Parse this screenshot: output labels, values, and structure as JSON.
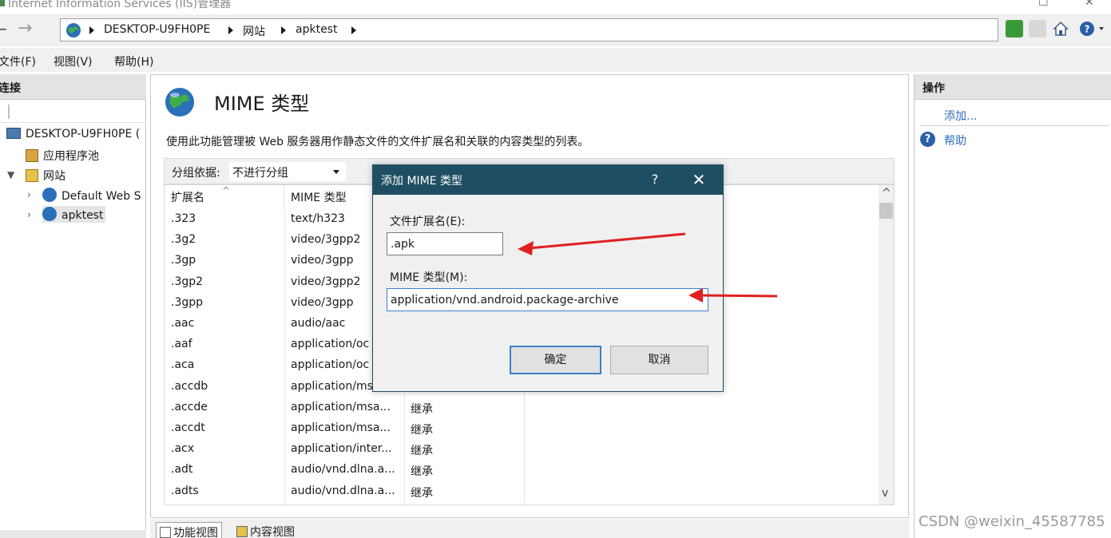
{
  "window": {
    "title": "Internet Information Services (IIS)管理器"
  },
  "address_bar": {
    "crumbs": [
      "DESKTOP-U9FH0PE",
      "网站",
      "apktest"
    ]
  },
  "menu": {
    "items": [
      "文件(F)",
      "视图(V)",
      "帮助(H)"
    ]
  },
  "connections": {
    "header": "连接",
    "tree": [
      {
        "label": "DESKTOP-U9FH0PE (",
        "level": 0
      },
      {
        "label": "应用程序池",
        "level": 1
      },
      {
        "label": "网站",
        "level": 1
      },
      {
        "label": "Default Web S",
        "level": 2
      },
      {
        "label": "apktest",
        "level": 2,
        "selected": true
      }
    ]
  },
  "main": {
    "title": "MIME 类型",
    "description": "使用此功能管理被 Web 服务器用作静态文件的文件扩展名和关联的内容类型的列表。",
    "group_by_label": "分组依据:",
    "group_by_value": "不进行分组",
    "columns": [
      "扩展名",
      "MIME 类型",
      ""
    ],
    "rows": [
      {
        "ext": ".323",
        "mime": "text/h323",
        "entry": ""
      },
      {
        "ext": ".3g2",
        "mime": "video/3gpp2",
        "entry": ""
      },
      {
        "ext": ".3gp",
        "mime": "video/3gpp",
        "entry": ""
      },
      {
        "ext": ".3gp2",
        "mime": "video/3gpp2",
        "entry": ""
      },
      {
        "ext": ".3gpp",
        "mime": "video/3gpp",
        "entry": ""
      },
      {
        "ext": ".aac",
        "mime": "audio/aac",
        "entry": ""
      },
      {
        "ext": ".aaf",
        "mime": "application/oc",
        "entry": ""
      },
      {
        "ext": ".aca",
        "mime": "application/oc",
        "entry": ""
      },
      {
        "ext": ".accdb",
        "mime": "application/ms",
        "entry": ""
      },
      {
        "ext": ".accde",
        "mime": "application/msa...",
        "entry": "继承"
      },
      {
        "ext": ".accdt",
        "mime": "application/msa...",
        "entry": "继承"
      },
      {
        "ext": ".acx",
        "mime": "application/inter...",
        "entry": "继承"
      },
      {
        "ext": ".adt",
        "mime": "audio/vnd.dlna.a...",
        "entry": "继承"
      },
      {
        "ext": ".adts",
        "mime": "audio/vnd.dlna.a...",
        "entry": "继承"
      }
    ],
    "bottom_tabs": [
      "功能视图",
      "内容视图"
    ]
  },
  "actions": {
    "header": "操作",
    "add": "添加...",
    "help": "帮助"
  },
  "dialog": {
    "title": "添加 MIME 类型",
    "help_glyph": "?",
    "close_glyph": "✕",
    "ext_label": "文件扩展名(E):",
    "ext_value": ".apk",
    "mime_label": "MIME 类型(M):",
    "mime_value": "application/vnd.android.package-archive",
    "ok": "确定",
    "cancel": "取消"
  },
  "watermark": "CSDN @weixin_45587785",
  "colors": {
    "dialog_header": "#1f4e63",
    "accent_blue": "#3b7fcf",
    "link_blue": "#2c6ebd",
    "annotation_red": "#e02020"
  }
}
